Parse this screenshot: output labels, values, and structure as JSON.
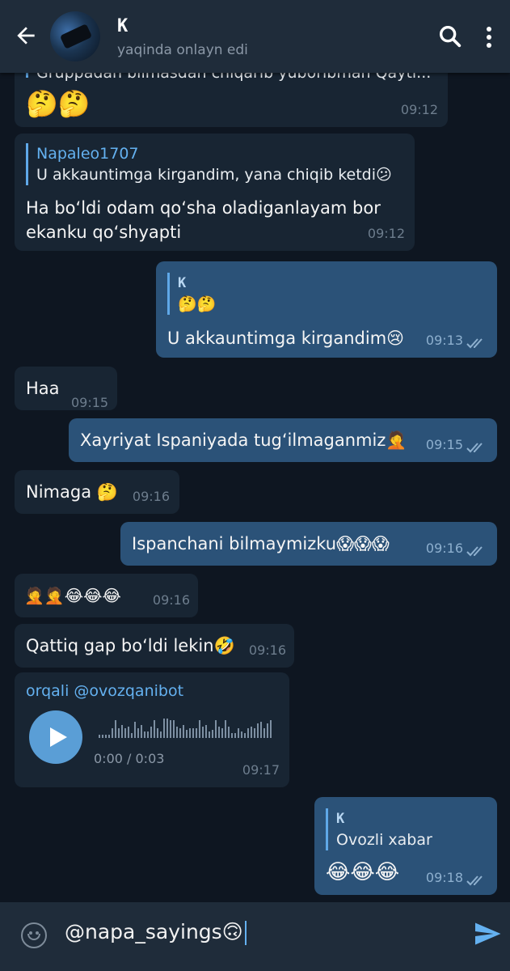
{
  "header": {
    "title": "K",
    "subtitle": "yaqinda onlayn edi"
  },
  "messages": [
    {
      "id": "m1",
      "dir": "in",
      "quoted_partial": "Gruppadan bilmasdan chiqarib yuboribman Qayti...",
      "text": "🤔🤔",
      "time": "09:12"
    },
    {
      "id": "m2",
      "dir": "in",
      "reply_name": "Napaleo1707",
      "reply_text": "U akkauntimga kirgandim, yana chiqib ketdi😕",
      "text_line1": "Ha bo‘ldi odam qo‘sha oladiganlayam bor",
      "text_line2": "ekanku qo‘shyapti",
      "time": "09:12"
    },
    {
      "id": "m3",
      "dir": "out",
      "reply_name": "K",
      "reply_text": "🤔🤔",
      "text": "U akkauntimga kirgandim😢",
      "time": "09:13",
      "status": "read"
    },
    {
      "id": "m4",
      "dir": "in",
      "text": "Haa",
      "time": "09:15"
    },
    {
      "id": "m5",
      "dir": "out",
      "text": "Xayriyat Ispaniyada tug‘ilmaganmiz🤦",
      "time": "09:15",
      "status": "read"
    },
    {
      "id": "m6",
      "dir": "in",
      "text": "Nimaga 🤔",
      "time": "09:16"
    },
    {
      "id": "m7",
      "dir": "out",
      "text": "Ispanchani bilmaymizku😱😱😱",
      "time": "09:16",
      "status": "read"
    },
    {
      "id": "m8",
      "dir": "in",
      "text": "🤦🤦😂😂😂",
      "time": "09:16"
    },
    {
      "id": "m9",
      "dir": "in",
      "text": "Qattiq gap bo‘ldi lekin🤣",
      "time": "09:16"
    },
    {
      "id": "m10",
      "dir": "in",
      "via": "orqali @ovozqanibot",
      "voice_duration": "0:00 / 0:03",
      "time": "09:17"
    },
    {
      "id": "m11",
      "dir": "out",
      "reply_name": "K",
      "reply_text": "Ovozli xabar",
      "text": "😂😂😂",
      "time": "09:18",
      "status": "read"
    }
  ],
  "input": {
    "value": "@napa_sayings🙃"
  },
  "icons": {
    "back": "arrow-left-icon",
    "search": "search-icon",
    "more": "more-vertical-icon",
    "emoji": "smile-icon",
    "send": "send-icon",
    "play": "play-icon"
  },
  "colors": {
    "background": "#0e1621",
    "incoming_bubble": "#182533",
    "outgoing_bubble": "#2b5278",
    "accent": "#64b1f0",
    "header": "#1f2c3a"
  }
}
